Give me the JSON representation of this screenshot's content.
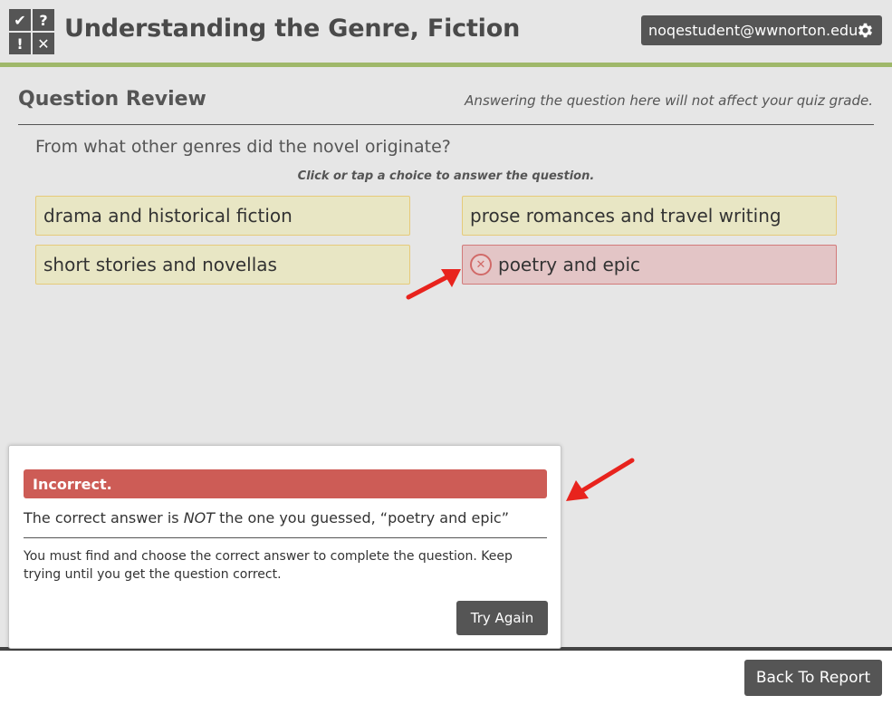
{
  "header": {
    "logo_glyphs": [
      "✔",
      "?",
      "!",
      "✕"
    ],
    "title": "Understanding the Genre, Fiction",
    "user_email": "noqestudent@wwnorton.edu",
    "settings_icon": "gear-icon",
    "accent_color": "#9fb86a"
  },
  "review": {
    "title": "Question Review",
    "note": "Answering the question here will not affect your quiz grade.",
    "question": "From what other genres did the novel originate?",
    "instruction": "Click or tap a choice to answer the question.",
    "choices": [
      {
        "label": "drama and historical fiction",
        "state": "unanswered"
      },
      {
        "label": "prose romances and travel writing",
        "state": "unanswered"
      },
      {
        "label": "short stories and novellas",
        "state": "unanswered"
      },
      {
        "label": "poetry and epic",
        "state": "incorrect",
        "icon": "x-circle-icon"
      }
    ]
  },
  "feedback": {
    "status": "Incorrect.",
    "main_prefix": "The correct answer is ",
    "main_emphasis": "NOT",
    "main_suffix": " the one you guessed, “poetry and epic”",
    "detail": "You must find and choose the correct answer to complete the question. Keep trying until you get the question correct.",
    "try_again_label": "Try Again",
    "status_color": "#cd5c56"
  },
  "footer": {
    "back_label": "Back To Report"
  }
}
